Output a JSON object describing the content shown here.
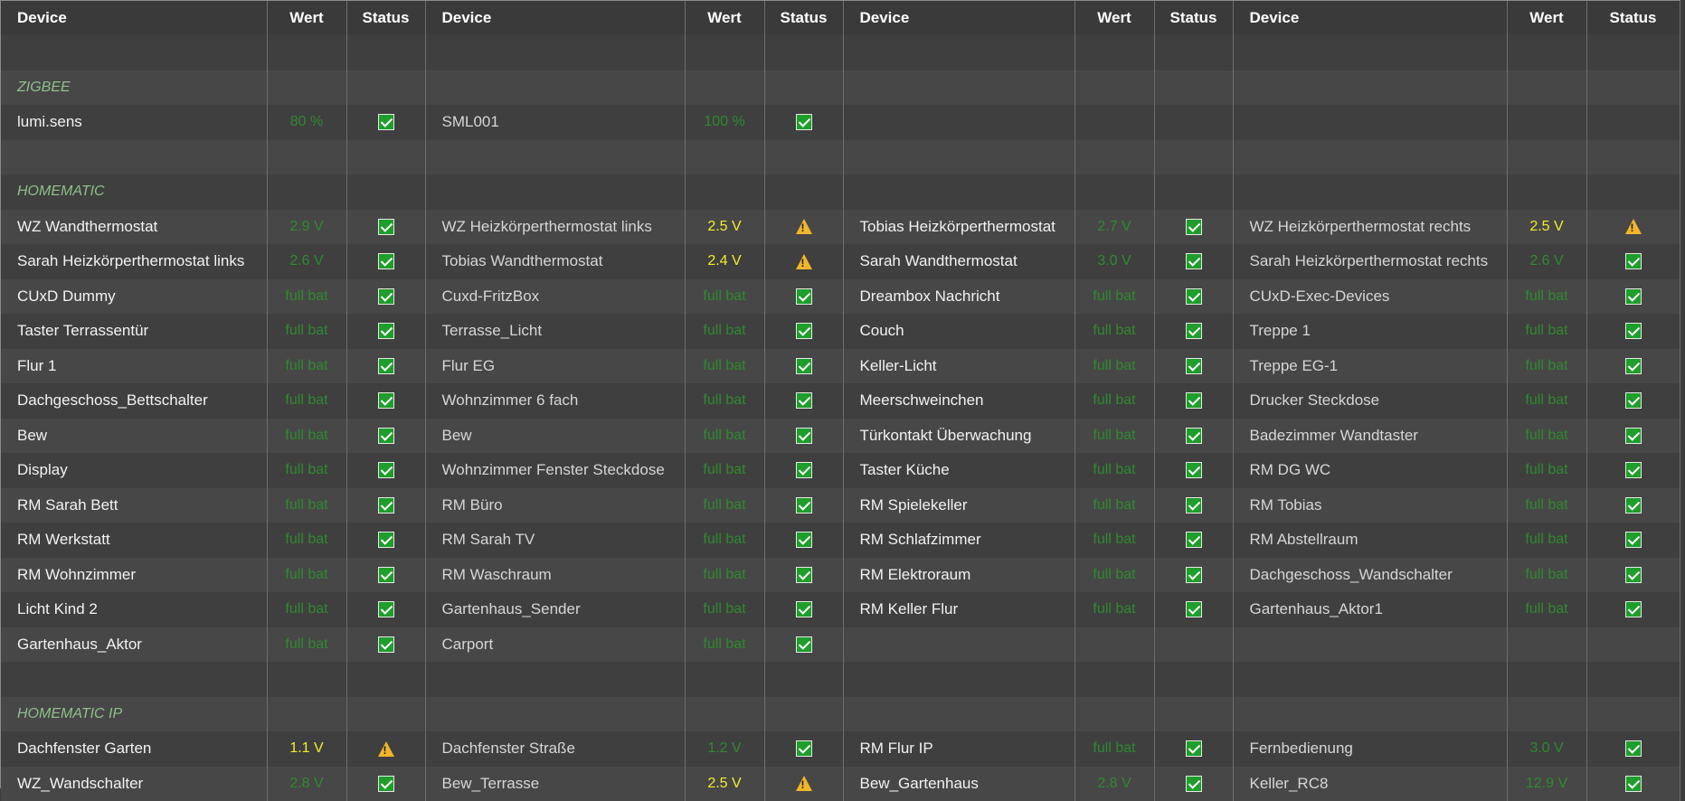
{
  "headers": {
    "device": "Device",
    "value": "Wert",
    "status": "Status"
  },
  "colors": {
    "ok_value": "#2f8a2f",
    "warn_value": "#f2ee2a",
    "section": "#8fbf8a",
    "status_ok": "#1e9e2a",
    "status_warn": "#f1b52a"
  },
  "rows": [
    {
      "type": "blank"
    },
    {
      "type": "section",
      "title": "ZIGBEE"
    },
    {
      "type": "data",
      "cells": [
        {
          "device": "lumi.sens",
          "value": "80 %",
          "level": "ok",
          "status": "ok"
        },
        {
          "device": "SML001",
          "value": "100 %",
          "level": "ok",
          "status": "ok"
        },
        null,
        null
      ]
    },
    {
      "type": "blank"
    },
    {
      "type": "section",
      "title": "HOMEMATIC"
    },
    {
      "type": "data",
      "cells": [
        {
          "device": "WZ Wandthermostat",
          "value": "2.9 V",
          "level": "ok",
          "status": "ok"
        },
        {
          "device": "WZ Heizkörperthermostat links",
          "value": "2.5 V",
          "level": "warn",
          "status": "warn"
        },
        {
          "device": "Tobias Heizkörperthermostat",
          "value": "2.7 V",
          "level": "ok",
          "status": "ok"
        },
        {
          "device": "WZ Heizkörperthermostat rechts",
          "value": "2.5 V",
          "level": "warn",
          "status": "warn"
        }
      ]
    },
    {
      "type": "data",
      "cells": [
        {
          "device": "Sarah Heizkörperthermostat links",
          "value": "2.6 V",
          "level": "ok",
          "status": "ok"
        },
        {
          "device": "Tobias Wandthermostat",
          "value": "2.4 V",
          "level": "warn",
          "status": "warn"
        },
        {
          "device": "Sarah Wandthermostat",
          "value": "3.0 V",
          "level": "ok",
          "status": "ok"
        },
        {
          "device": "Sarah Heizkörperthermostat rechts",
          "value": "2.6 V",
          "level": "ok",
          "status": "ok"
        }
      ]
    },
    {
      "type": "data",
      "cells": [
        {
          "device": "CUxD Dummy",
          "value": "full bat",
          "level": "ok",
          "status": "ok"
        },
        {
          "device": "Cuxd-FritzBox",
          "value": "full bat",
          "level": "ok",
          "status": "ok"
        },
        {
          "device": "Dreambox Nachricht",
          "value": "full bat",
          "level": "ok",
          "status": "ok"
        },
        {
          "device": "CUxD-Exec-Devices",
          "value": "full bat",
          "level": "ok",
          "status": "ok"
        }
      ]
    },
    {
      "type": "data",
      "cells": [
        {
          "device": "Taster Terrassentür",
          "value": "full bat",
          "level": "ok",
          "status": "ok"
        },
        {
          "device": "Terrasse_Licht",
          "value": "full bat",
          "level": "ok",
          "status": "ok"
        },
        {
          "device": "Couch",
          "value": "full bat",
          "level": "ok",
          "status": "ok"
        },
        {
          "device": "Treppe 1",
          "value": "full bat",
          "level": "ok",
          "status": "ok"
        }
      ]
    },
    {
      "type": "data",
      "cells": [
        {
          "device": "Flur 1",
          "value": "full bat",
          "level": "ok",
          "status": "ok"
        },
        {
          "device": "Flur EG",
          "value": "full bat",
          "level": "ok",
          "status": "ok"
        },
        {
          "device": "Keller-Licht",
          "value": "full bat",
          "level": "ok",
          "status": "ok"
        },
        {
          "device": "Treppe EG-1",
          "value": "full bat",
          "level": "ok",
          "status": "ok"
        }
      ]
    },
    {
      "type": "data",
      "cells": [
        {
          "device": "Dachgeschoss_Bettschalter",
          "value": "full bat",
          "level": "ok",
          "status": "ok"
        },
        {
          "device": "Wohnzimmer 6 fach",
          "value": "full bat",
          "level": "ok",
          "status": "ok"
        },
        {
          "device": "Meerschweinchen",
          "value": "full bat",
          "level": "ok",
          "status": "ok"
        },
        {
          "device": "Drucker Steckdose",
          "value": "full bat",
          "level": "ok",
          "status": "ok"
        }
      ]
    },
    {
      "type": "data",
      "cells": [
        {
          "device": "Bew",
          "value": "full bat",
          "level": "ok",
          "status": "ok"
        },
        {
          "device": "Bew",
          "value": "full bat",
          "level": "ok",
          "status": "ok"
        },
        {
          "device": "Türkontakt Überwachung",
          "value": "full bat",
          "level": "ok",
          "status": "ok"
        },
        {
          "device": "Badezimmer Wandtaster",
          "value": "full bat",
          "level": "ok",
          "status": "ok"
        }
      ]
    },
    {
      "type": "data",
      "cells": [
        {
          "device": "Display",
          "value": "full bat",
          "level": "ok",
          "status": "ok"
        },
        {
          "device": "Wohnzimmer Fenster Steckdose",
          "value": "full bat",
          "level": "ok",
          "status": "ok"
        },
        {
          "device": "Taster Küche",
          "value": "full bat",
          "level": "ok",
          "status": "ok"
        },
        {
          "device": "RM DG WC",
          "value": "full bat",
          "level": "ok",
          "status": "ok"
        }
      ]
    },
    {
      "type": "data",
      "cells": [
        {
          "device": "RM Sarah Bett",
          "value": "full bat",
          "level": "ok",
          "status": "ok"
        },
        {
          "device": "RM Büro",
          "value": "full bat",
          "level": "ok",
          "status": "ok"
        },
        {
          "device": "RM Spielekeller",
          "value": "full bat",
          "level": "ok",
          "status": "ok"
        },
        {
          "device": "RM Tobias",
          "value": "full bat",
          "level": "ok",
          "status": "ok"
        }
      ]
    },
    {
      "type": "data",
      "cells": [
        {
          "device": "RM Werkstatt",
          "value": "full bat",
          "level": "ok",
          "status": "ok"
        },
        {
          "device": "RM Sarah TV",
          "value": "full bat",
          "level": "ok",
          "status": "ok"
        },
        {
          "device": "RM Schlafzimmer",
          "value": "full bat",
          "level": "ok",
          "status": "ok"
        },
        {
          "device": "RM Abstellraum",
          "value": "full bat",
          "level": "ok",
          "status": "ok"
        }
      ]
    },
    {
      "type": "data",
      "cells": [
        {
          "device": "RM Wohnzimmer",
          "value": "full bat",
          "level": "ok",
          "status": "ok"
        },
        {
          "device": "RM Waschraum",
          "value": "full bat",
          "level": "ok",
          "status": "ok"
        },
        {
          "device": "RM Elektroraum",
          "value": "full bat",
          "level": "ok",
          "status": "ok"
        },
        {
          "device": "Dachgeschoss_Wandschalter",
          "value": "full bat",
          "level": "ok",
          "status": "ok"
        }
      ]
    },
    {
      "type": "data",
      "cells": [
        {
          "device": "Licht Kind 2",
          "value": "full bat",
          "level": "ok",
          "status": "ok"
        },
        {
          "device": "Gartenhaus_Sender",
          "value": "full bat",
          "level": "ok",
          "status": "ok"
        },
        {
          "device": "RM Keller Flur",
          "value": "full bat",
          "level": "ok",
          "status": "ok"
        },
        {
          "device": "Gartenhaus_Aktor1",
          "value": "full bat",
          "level": "ok",
          "status": "ok"
        }
      ]
    },
    {
      "type": "data",
      "cells": [
        {
          "device": "Gartenhaus_Aktor",
          "value": "full bat",
          "level": "ok",
          "status": "ok"
        },
        {
          "device": "Carport",
          "value": "full bat",
          "level": "ok",
          "status": "ok"
        },
        null,
        null
      ]
    },
    {
      "type": "blank"
    },
    {
      "type": "section",
      "title": "HOMEMATIC IP"
    },
    {
      "type": "data",
      "cells": [
        {
          "device": "Dachfenster Garten",
          "value": "1.1 V",
          "level": "warn",
          "status": "warn"
        },
        {
          "device": "Dachfenster Straße",
          "value": "1.2 V",
          "level": "ok",
          "status": "ok"
        },
        {
          "device": "RM Flur IP",
          "value": "full bat",
          "level": "ok",
          "status": "ok"
        },
        {
          "device": "Fernbedienung",
          "value": "3.0 V",
          "level": "ok",
          "status": "ok"
        }
      ]
    },
    {
      "type": "data",
      "cells": [
        {
          "device": "WZ_Wandschalter",
          "value": "2.8 V",
          "level": "ok",
          "status": "ok"
        },
        {
          "device": "Bew_Terrasse",
          "value": "2.5 V",
          "level": "warn",
          "status": "warn"
        },
        {
          "device": "Bew_Gartenhaus",
          "value": "2.8 V",
          "level": "ok",
          "status": "ok"
        },
        {
          "device": "Keller_RC8",
          "value": "12.9 V",
          "level": "ok",
          "status": "ok"
        }
      ]
    }
  ]
}
